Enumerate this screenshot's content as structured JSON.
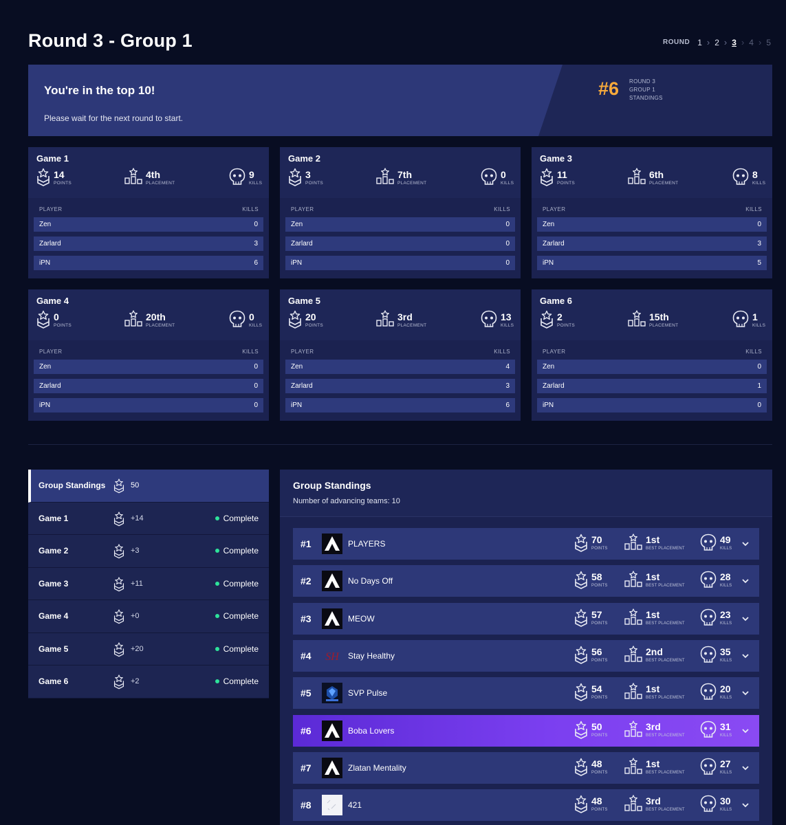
{
  "page_title": "Round 3 - Group 1",
  "round_nav": {
    "label": "ROUND",
    "rounds": [
      "1",
      "2",
      "3",
      "4",
      "5"
    ],
    "current": "3"
  },
  "banner": {
    "title": "You're in the top 10!",
    "subtitle": "Please wait for the next round to start.",
    "rank": "#6",
    "rank_label_1": "ROUND 3",
    "rank_label_2": "GROUP 1",
    "rank_label_3": "STANDINGS"
  },
  "labels": {
    "points": "POINTS",
    "placement": "PLACEMENT",
    "kills": "KILLS",
    "best_placement": "BEST PLACEMENT",
    "player_col": "PLAYER",
    "kills_col": "KILLS"
  },
  "games": [
    {
      "title": "Game 1",
      "points": "14",
      "placement": "4th",
      "kills": "9",
      "players": [
        {
          "name": "Zen",
          "kills": "0"
        },
        {
          "name": "Zarlard",
          "kills": "3"
        },
        {
          "name": "iPN",
          "kills": "6"
        }
      ]
    },
    {
      "title": "Game 2",
      "points": "3",
      "placement": "7th",
      "kills": "0",
      "players": [
        {
          "name": "Zen",
          "kills": "0"
        },
        {
          "name": "Zarlard",
          "kills": "0"
        },
        {
          "name": "iPN",
          "kills": "0"
        }
      ]
    },
    {
      "title": "Game 3",
      "points": "11",
      "placement": "6th",
      "kills": "8",
      "players": [
        {
          "name": "Zen",
          "kills": "0"
        },
        {
          "name": "Zarlard",
          "kills": "3"
        },
        {
          "name": "iPN",
          "kills": "5"
        }
      ]
    },
    {
      "title": "Game 4",
      "points": "0",
      "placement": "20th",
      "kills": "0",
      "players": [
        {
          "name": "Zen",
          "kills": "0"
        },
        {
          "name": "Zarlard",
          "kills": "0"
        },
        {
          "name": "iPN",
          "kills": "0"
        }
      ]
    },
    {
      "title": "Game 5",
      "points": "20",
      "placement": "3rd",
      "kills": "13",
      "players": [
        {
          "name": "Zen",
          "kills": "4"
        },
        {
          "name": "Zarlard",
          "kills": "3"
        },
        {
          "name": "iPN",
          "kills": "6"
        }
      ]
    },
    {
      "title": "Game 6",
      "points": "2",
      "placement": "15th",
      "kills": "1",
      "players": [
        {
          "name": "Zen",
          "kills": "0"
        },
        {
          "name": "Zarlard",
          "kills": "1"
        },
        {
          "name": "iPN",
          "kills": "0"
        }
      ]
    }
  ],
  "side_panel": [
    {
      "label": "Group Standings",
      "value": "50",
      "status": ""
    },
    {
      "label": "Game 1",
      "value": "+14",
      "status": "Complete"
    },
    {
      "label": "Game 2",
      "value": "+3",
      "status": "Complete"
    },
    {
      "label": "Game 3",
      "value": "+11",
      "status": "Complete"
    },
    {
      "label": "Game 4",
      "value": "+0",
      "status": "Complete"
    },
    {
      "label": "Game 5",
      "value": "+20",
      "status": "Complete"
    },
    {
      "label": "Game 6",
      "value": "+2",
      "status": "Complete"
    }
  ],
  "standings": {
    "title": "Group Standings",
    "subtitle": "Number of advancing teams: 10",
    "highlight_color": "#7b3ff0",
    "teams": [
      {
        "rank": "#1",
        "name": "PLAYERS",
        "points": "70",
        "best_placement": "1st",
        "kills": "49",
        "logo": "apex-logo"
      },
      {
        "rank": "#2",
        "name": "No Days Off",
        "points": "58",
        "best_placement": "1st",
        "kills": "28",
        "logo": "apex-logo"
      },
      {
        "rank": "#3",
        "name": "MEOW",
        "points": "57",
        "best_placement": "1st",
        "kills": "23",
        "logo": "apex-logo"
      },
      {
        "rank": "#4",
        "name": "Stay Healthy",
        "points": "56",
        "best_placement": "2nd",
        "kills": "35",
        "logo": "sh-logo"
      },
      {
        "rank": "#5",
        "name": "SVP Pulse",
        "points": "54",
        "best_placement": "1st",
        "kills": "20",
        "logo": "svp-logo"
      },
      {
        "rank": "#6",
        "name": "Boba Lovers",
        "points": "50",
        "best_placement": "3rd",
        "kills": "31",
        "logo": "apex-logo",
        "highlight": true
      },
      {
        "rank": "#7",
        "name": "Zlatan Mentality",
        "points": "48",
        "best_placement": "1st",
        "kills": "27",
        "logo": "apex-logo"
      },
      {
        "rank": "#8",
        "name": "421",
        "points": "48",
        "best_placement": "3rd",
        "kills": "30",
        "logo": "421-logo"
      }
    ]
  }
}
